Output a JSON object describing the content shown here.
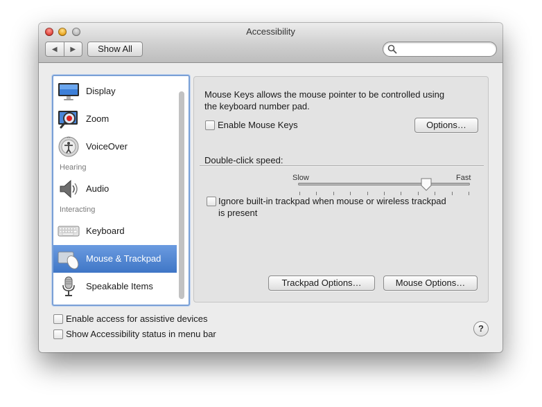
{
  "window": {
    "title": "Accessibility"
  },
  "toolbar": {
    "back_glyph": "◀",
    "forward_glyph": "▶",
    "show_all_label": "Show All",
    "search": {
      "value": "",
      "placeholder": ""
    }
  },
  "sidebar": {
    "items": [
      {
        "label": "Display",
        "icon": "display-icon"
      },
      {
        "label": "Zoom",
        "icon": "zoom-icon"
      },
      {
        "label": "VoiceOver",
        "icon": "voiceover-icon"
      },
      {
        "label": "Audio",
        "icon": "audio-speaker-icon"
      },
      {
        "label": "Keyboard",
        "icon": "keyboard-icon"
      },
      {
        "label": "Mouse & Trackpad",
        "icon": "mouse-trackpad-icon",
        "selected": true
      },
      {
        "label": "Speakable Items",
        "icon": "microphone-icon"
      }
    ],
    "headers": {
      "hearing": "Hearing",
      "interacting": "Interacting"
    }
  },
  "main": {
    "mouse_keys_desc_line1": "Mouse Keys allows the mouse pointer to be controlled using",
    "mouse_keys_desc_line2": "the keyboard number pad.",
    "enable_mouse_keys_label": "Enable Mouse Keys",
    "enable_mouse_keys_checked": false,
    "options_button": "Options…",
    "double_click_label": "Double-click speed:",
    "slider": {
      "min_label": "Slow",
      "max_label": "Fast",
      "value_fraction": 0.75
    },
    "ignore_trackpad_line1": "Ignore built-in trackpad when mouse or wireless trackpad",
    "ignore_trackpad_line2": "is present",
    "ignore_trackpad_checked": false,
    "trackpad_options_button": "Trackpad Options…",
    "mouse_options_button": "Mouse Options…"
  },
  "footer": {
    "assistive_label": "Enable access for assistive devices",
    "assistive_checked": false,
    "status_menu_label": "Show Accessibility status in menu bar",
    "status_menu_checked": false,
    "help_glyph": "?"
  },
  "colors": {
    "selection": "#3f76c6",
    "window_bg": "#ececec"
  }
}
